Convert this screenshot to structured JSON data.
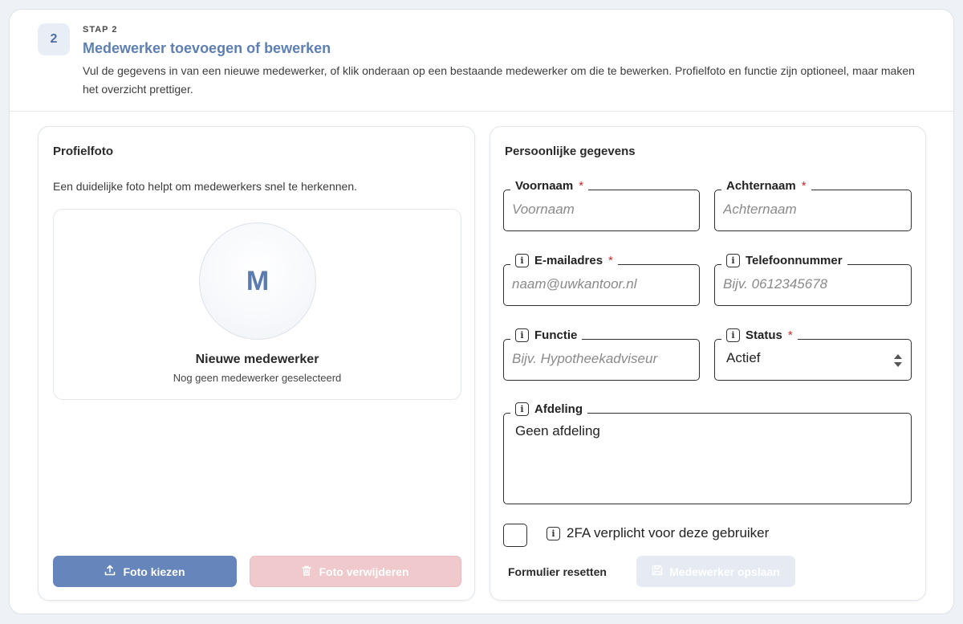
{
  "step": {
    "number": "2",
    "kicker": "STAP 2",
    "title": "Medewerker toevoegen of bewerken",
    "description": "Vul de gegevens in van een nieuwe medewerker, of klik onderaan op een bestaande medewerker om die te bewerken. Profielfoto en functie zijn optioneel, maar maken het overzicht prettiger."
  },
  "profile": {
    "title": "Profielfoto",
    "hint": "Een duidelijke foto helpt om medewerkers snel te herkennen.",
    "avatar_initial": "M",
    "name": "Nieuwe medewerker",
    "subtitle": "Nog geen medewerker geselecteerd",
    "choose_label": "Foto kiezen",
    "remove_label": "Foto verwijderen"
  },
  "personal": {
    "title": "Persoonlijke gegevens",
    "first_name": {
      "label": "Voornaam",
      "placeholder": "Voornaam",
      "value": ""
    },
    "last_name": {
      "label": "Achternaam",
      "placeholder": "Achternaam",
      "value": ""
    },
    "email": {
      "label": "E-mailadres",
      "placeholder": "naam@uwkantoor.nl",
      "value": ""
    },
    "phone": {
      "label": "Telefoonnummer",
      "placeholder": "Bijv. 0612345678",
      "value": ""
    },
    "function": {
      "label": "Functie",
      "placeholder": "Bijv. Hypotheekadviseur",
      "value": ""
    },
    "status": {
      "label": "Status",
      "value": "Actief"
    },
    "department": {
      "label": "Afdeling",
      "value": "Geen afdeling"
    },
    "required_marker": "*",
    "twofa_label": "2FA verplicht voor deze gebruiker",
    "reset_label": "Formulier resetten",
    "save_label": "Medewerker opslaan"
  }
}
